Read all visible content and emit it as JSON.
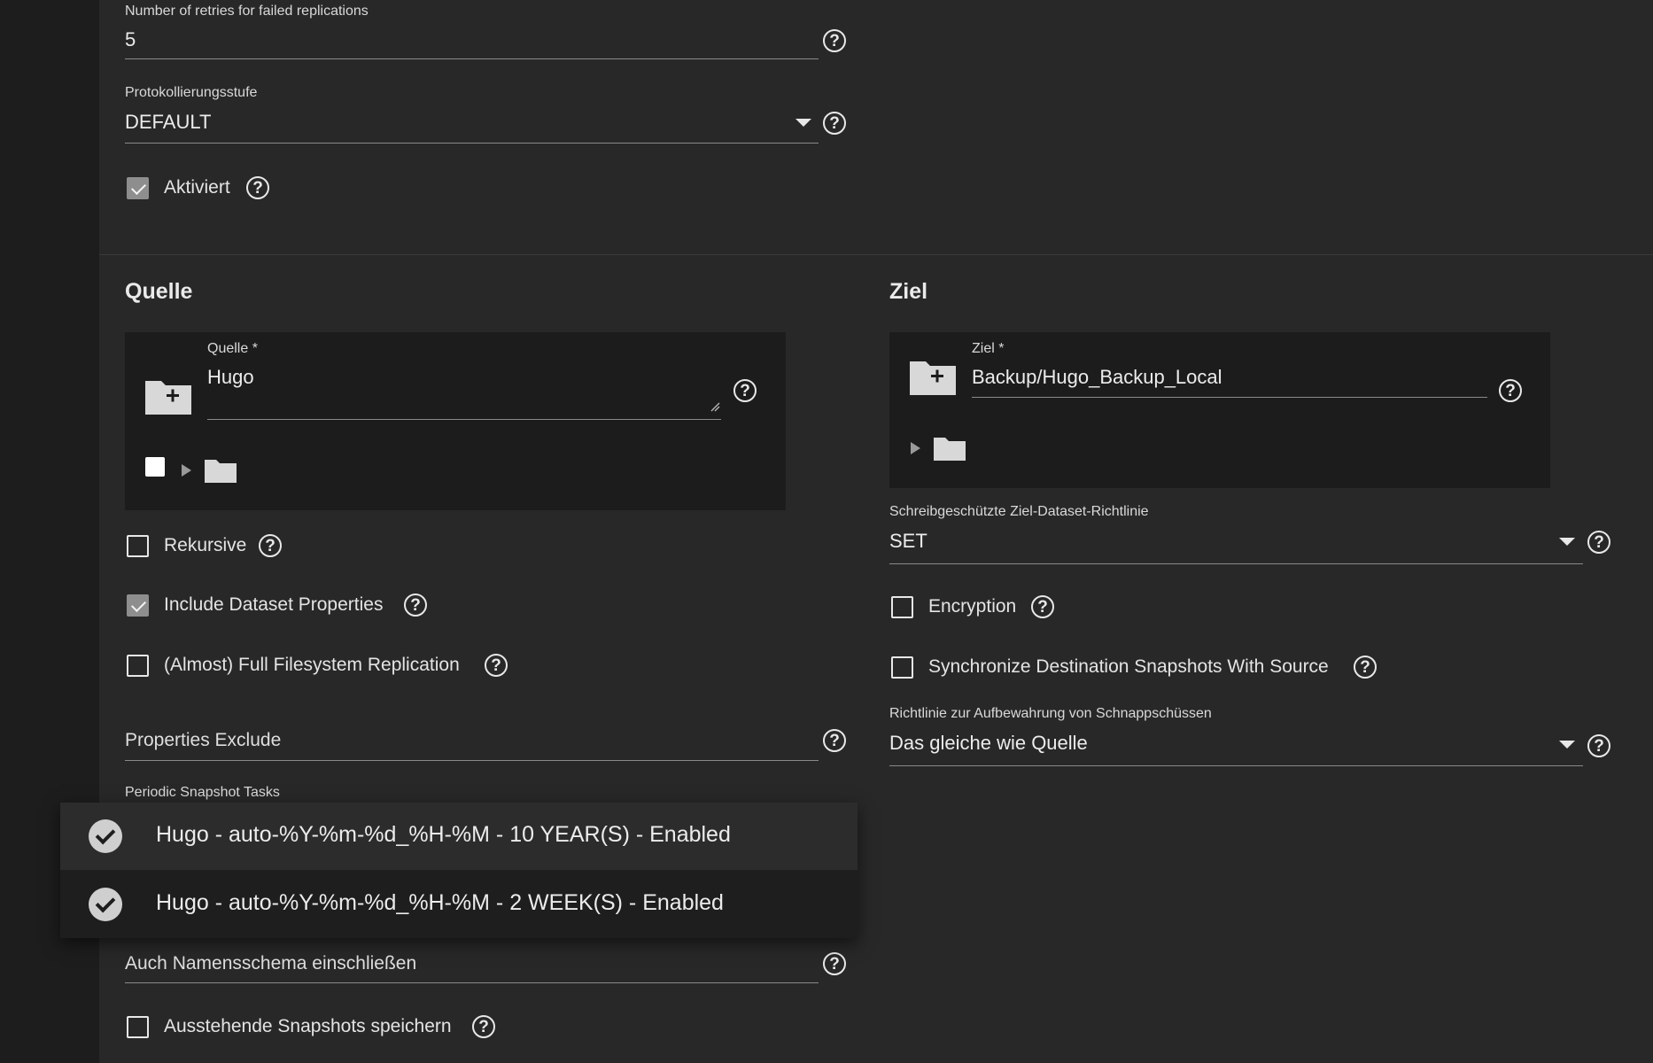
{
  "general": {
    "retries": {
      "label": "Number of retries for failed replications",
      "value": "5"
    },
    "log_level": {
      "label": "Protokollierungsstufe",
      "value": "DEFAULT"
    },
    "enabled": {
      "label": "Aktiviert",
      "checked": true
    }
  },
  "source": {
    "title": "Quelle",
    "field": {
      "label": "Quelle *",
      "value": "Hugo"
    },
    "recursive": {
      "label": "Rekursive",
      "checked": false
    },
    "include_props": {
      "label": "Include Dataset Properties",
      "checked": true
    },
    "full_fs": {
      "label": "(Almost) Full Filesystem Replication",
      "checked": false
    },
    "props_exclude": {
      "placeholder": "Properties Exclude"
    },
    "periodic_tasks_label": "Periodic Snapshot Tasks",
    "also_naming": {
      "placeholder": "Auch Namensschema einschließen"
    },
    "save_pending": {
      "label": "Ausstehende Snapshots speichern",
      "checked": false
    }
  },
  "dest": {
    "title": "Ziel",
    "field": {
      "label": "Ziel *",
      "value": "Backup/Hugo_Backup_Local"
    },
    "readonly_policy": {
      "label": "Schreibgeschützte Ziel-Dataset-Richtlinie",
      "value": "SET"
    },
    "encryption": {
      "label": "Encryption",
      "checked": false
    },
    "sync_snapshots": {
      "label": "Synchronize Destination Snapshots With Source",
      "checked": false
    },
    "retention": {
      "label": "Richtlinie zur Aufbewahrung von Schnappschüssen",
      "value": "Das gleiche wie Quelle"
    }
  },
  "dropdown": {
    "items": [
      {
        "label": "Hugo - auto-%Y-%m-%d_%H-%M - 10 YEAR(S) - Enabled",
        "selected": true
      },
      {
        "label": "Hugo - auto-%Y-%m-%d_%H-%M - 2 WEEK(S) - Enabled",
        "selected": true
      }
    ]
  },
  "icons": {
    "help": "help-circle-icon",
    "folder_add": "folder-plus-icon",
    "folder": "folder-icon",
    "expand": "triangle-right-icon",
    "check": "check-circle-icon"
  },
  "colors": {
    "background": "#282828",
    "sidebar": "#1d1d1d",
    "panel": "#1c1c1c",
    "text": "#e6e6e6"
  }
}
